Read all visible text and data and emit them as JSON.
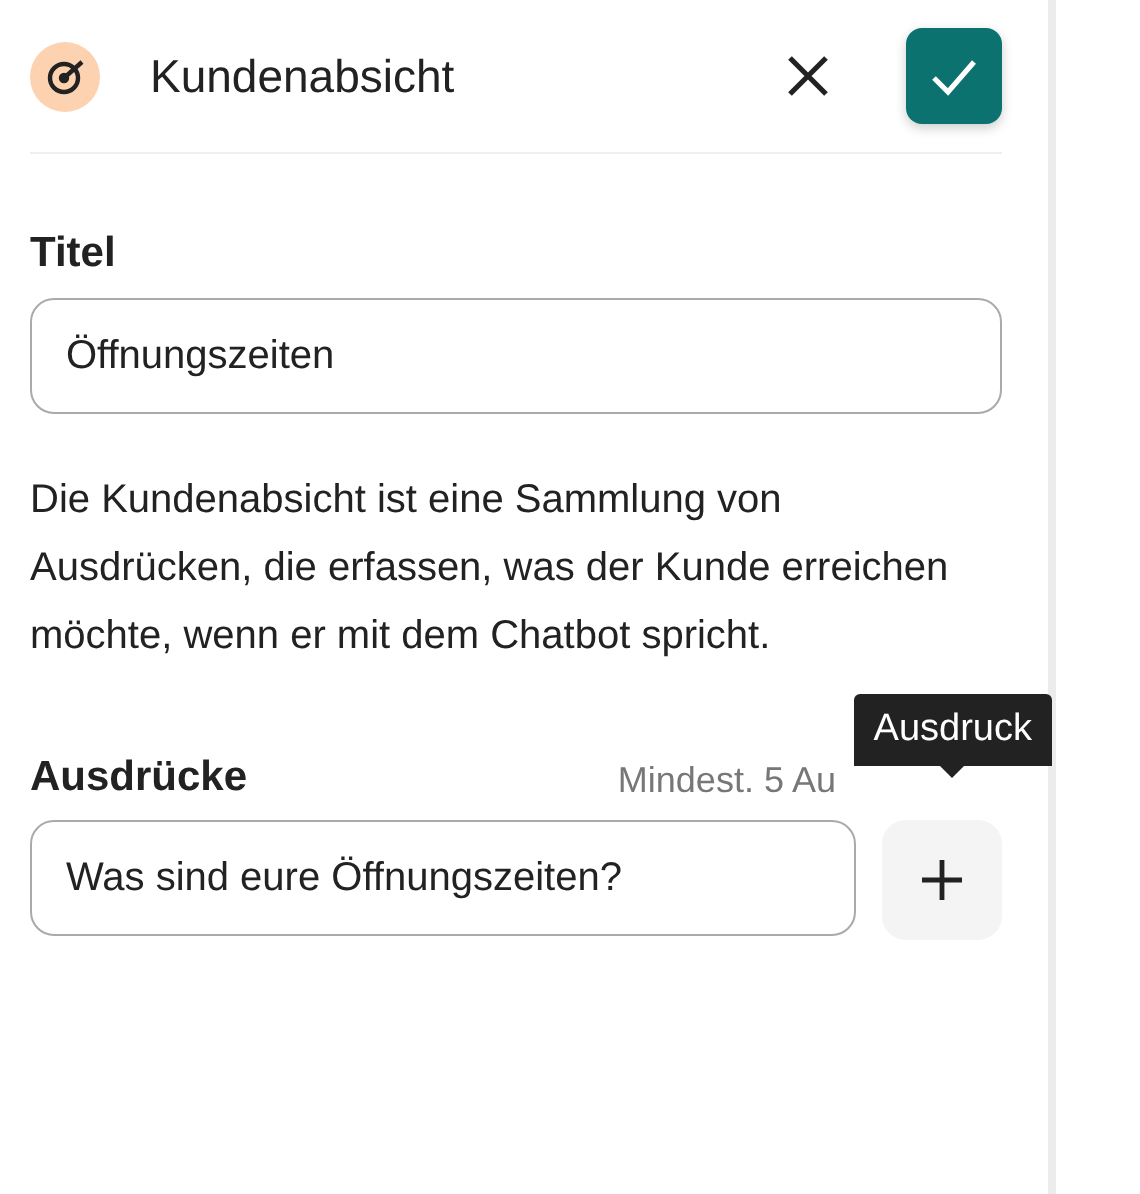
{
  "header": {
    "title": "Kundenabsicht"
  },
  "title_field": {
    "label": "Titel",
    "value": "Öffnungszeiten"
  },
  "description": "Die Kundenabsicht ist eine Sammlung von Ausdrücken, die erfassen, was der Kunde erreichen möchte, wenn er mit dem Chatbot spricht.",
  "expressions": {
    "label": "Ausdrücke",
    "hint": "Mindest. 5 Au",
    "add_tooltip": "Ausdruck",
    "items": [
      {
        "value": "Was sind eure Öffnungszeiten?"
      }
    ]
  }
}
